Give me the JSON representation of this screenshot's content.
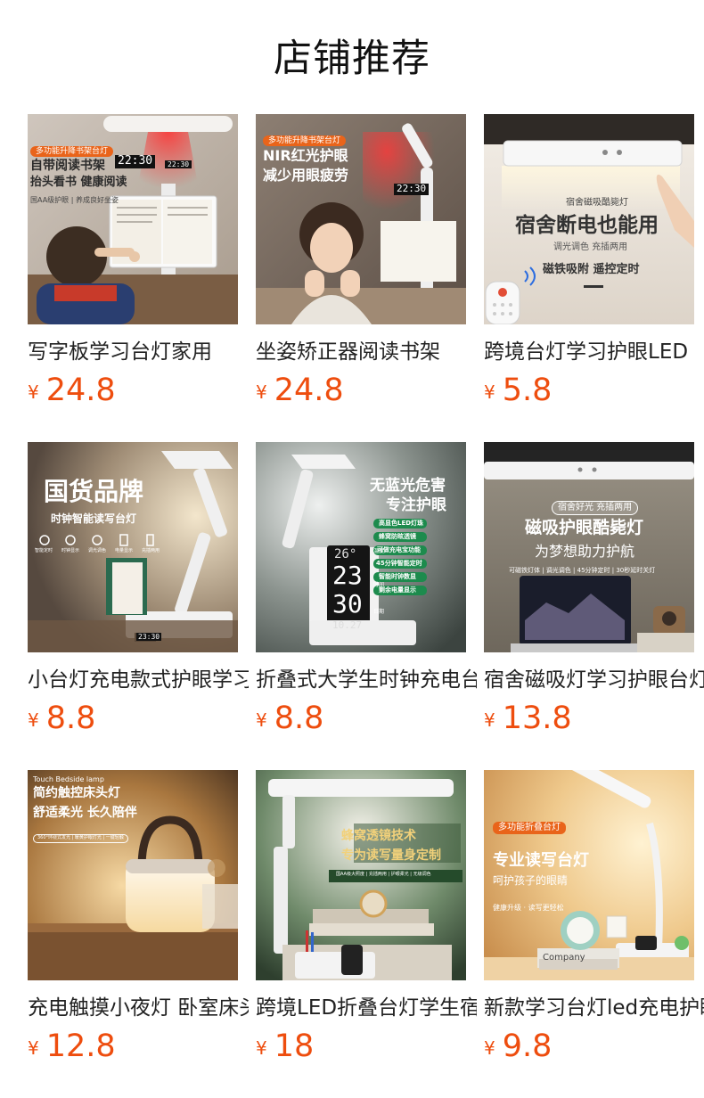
{
  "header": {
    "title": "店铺推荐"
  },
  "currency_symbol": "¥",
  "products": [
    {
      "name": "写字板学习台灯家用",
      "price": "24.8",
      "image": {
        "tag": "多功能升降书架台灯",
        "line1": "自带阅读书架",
        "line2": "抬头看书 健康阅读",
        "sub": "国AA级护眼 | 养成良好坐姿",
        "clock": "22:30",
        "clock_small": "22:30"
      }
    },
    {
      "name": "坐姿矫正器阅读书架",
      "price": "24.8",
      "image": {
        "tag": "多功能升降书架台灯",
        "line1": "NIR红光护眼",
        "line2": "减少用眼疲劳",
        "clock": "22:30"
      }
    },
    {
      "name": "跨境台灯学习护眼LED",
      "price": "5.8",
      "image": {
        "sign_small": "宿舍磁吸酷毙灯",
        "sign_big": "宿舍断电也能用",
        "sign_sub": "调光调色 充插两用",
        "sign_foot": "磁铁吸附 遥控定时"
      }
    },
    {
      "name": "小台灯充电款式护眼学习",
      "price": "8.8",
      "image": {
        "brand": "国货品牌",
        "sub": "时钟智能读写台灯",
        "features": [
          "智能定时",
          "时钟显示",
          "调光调色",
          "电量显示",
          "充插两用"
        ],
        "clock": "23:30"
      }
    },
    {
      "name": "折叠式大学生时钟充电台灯",
      "price": "8.8",
      "image": {
        "line1": "无蓝光危害",
        "line2": "专注护眼",
        "badges": [
          "高显色LED灯珠",
          "蜂窝防眩透镜",
          "可做充电宝功能",
          "45分钟智能定时",
          "智能时钟数显",
          "剩余电量显示"
        ],
        "temp": "26°",
        "hour": "23",
        "minute": "30",
        "date": "10.27",
        "side_labels": [
          "温度",
          "时间",
          "日期"
        ]
      }
    },
    {
      "name": "宿舍磁吸灯学习护眼台灯",
      "price": "13.8",
      "image": {
        "pill": "宿舍好光 充插两用",
        "line1": "磁吸护眼酷毙灯",
        "line2": "为梦想助力护航",
        "sub": "可磁铁灯体 | 调光调色 | 45分钟定时 | 30秒延时关灯"
      }
    },
    {
      "name": "充电触摸小夜灯 卧室床头",
      "price": "12.8",
      "image": {
        "tiny": "Touch Bedside lamp",
        "line1": "简约触控床头灯",
        "line2": "舒适柔光 长久陪伴",
        "note": "360°环绕式发光 | 暖黄护眼灯光 | 一键轻触"
      }
    },
    {
      "name": "跨境LED折叠台灯学生宿舍",
      "price": "18",
      "image": {
        "line1": "蜂窝透镜技术",
        "line2": "专为读写量身定制",
        "strip": "国AA级大照度 | 充插两用 | 护眼柔光 | 无级调色"
      }
    },
    {
      "name": "新款学习台灯led充电护眼",
      "price": "9.8",
      "image": {
        "tag": "多功能折叠台灯",
        "line1": "专业读写台灯",
        "line2": "呵护孩子的眼睛",
        "sub": "健康升级 · 读写更轻松",
        "book": "Company"
      }
    }
  ]
}
